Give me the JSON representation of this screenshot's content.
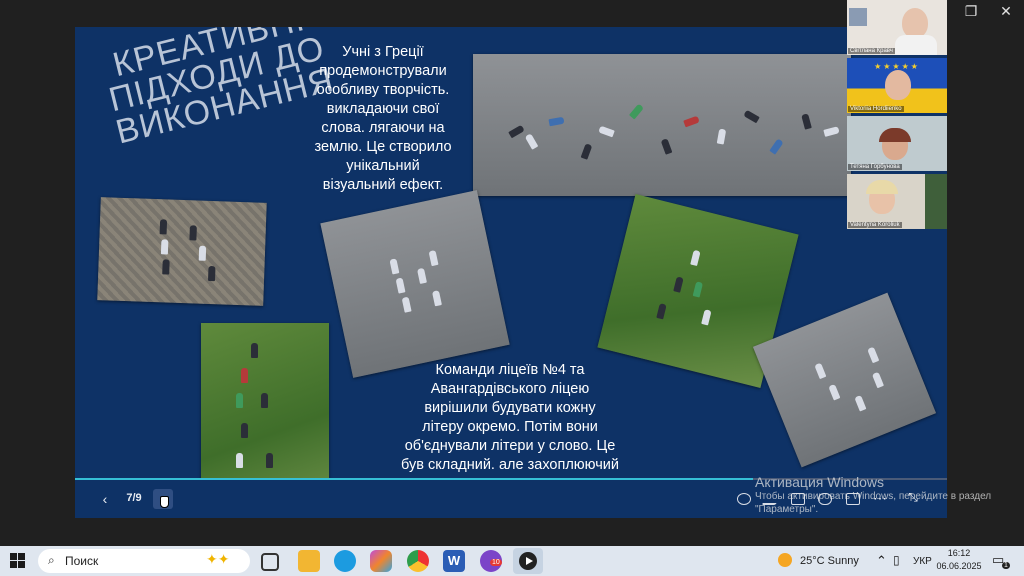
{
  "window": {
    "minimize": "—",
    "restore": "❐",
    "close": "✕"
  },
  "slide": {
    "title": "КРЕАТИВНІ ПІДХОДИ ДО ВИКОНАННЯ",
    "text_top": "Учні з Греції\nпродемонстрували\nособливу творчість.\nвикладаючи свої\nслова. лягаючи на\nземлю. Це створило\nунікальний\nвізуальний ефект.",
    "text_bottom": "Команди ліцеїв №4 та\nАвангардівського ліцею\nвирішили будувати кожну\nлітеру окремо. Потім вони\nоб'єднували літери у слово. Це\nбув складний. але захоплюючий\nпроцес.",
    "colors": {
      "background": "#0e3266",
      "accent": "#36c0d6"
    }
  },
  "player": {
    "prev": "‹",
    "page": "7/9",
    "next": "›",
    "progress": 0.778,
    "icons": [
      "zoom-icon",
      "pen-icon",
      "subtitles-icon",
      "audio-icon",
      "screen-icon",
      "more-icon",
      "exit-fullscreen-icon"
    ]
  },
  "participants": [
    {
      "name": "Світлана Кравч"
    },
    {
      "name": "Viktoriia Hordiienko"
    },
    {
      "name": "Тетяна Горбунова"
    },
    {
      "name": "Valentyna Koroliuk"
    }
  ],
  "watermark": {
    "line1": "Активация Windows",
    "line2": "Чтобы активировать Windows, перейдите в раздел \"Параметры\"."
  },
  "taskbar": {
    "search_placeholder": "Поиск",
    "weather": "25°C  Sunny",
    "language": "УКР",
    "time": "16:12",
    "date": "06.06.2025",
    "notification_count": "1",
    "badge_count": "10"
  }
}
